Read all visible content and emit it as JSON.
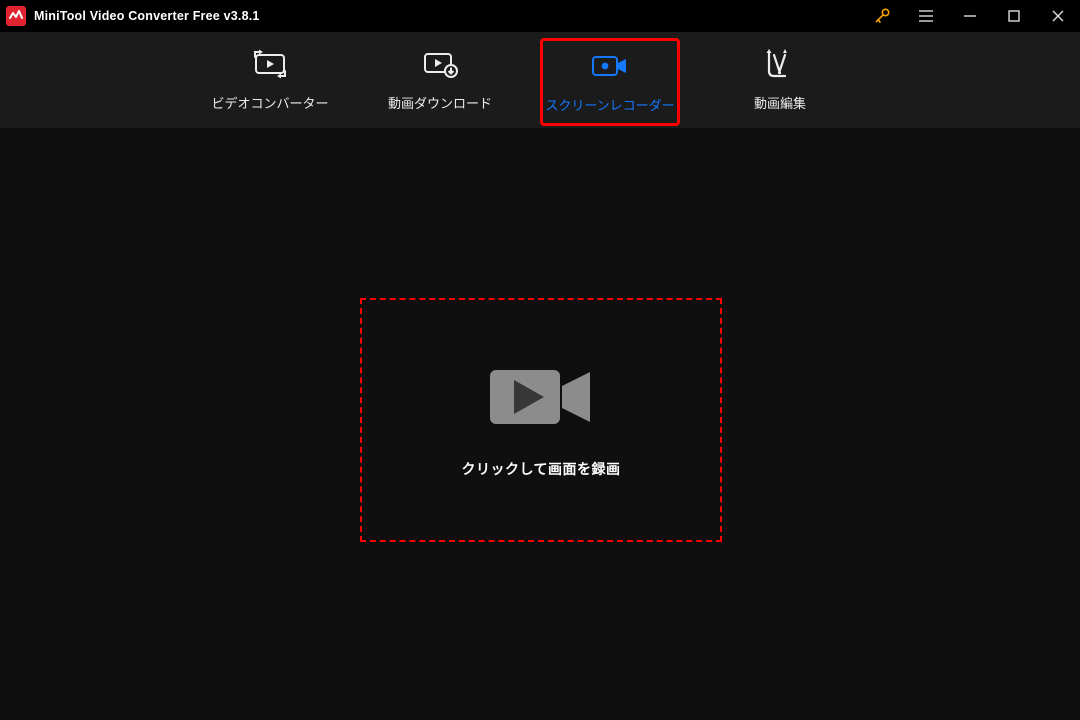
{
  "titlebar": {
    "app_name": "MiniTool Video Converter Free v3.8.1"
  },
  "tabs": {
    "converter": "ビデオコンバーター",
    "downloader": "動画ダウンロード",
    "recorder": "スクリーンレコーダー",
    "editor": "動画編集"
  },
  "main": {
    "record_label": "クリックして画面を録画"
  }
}
